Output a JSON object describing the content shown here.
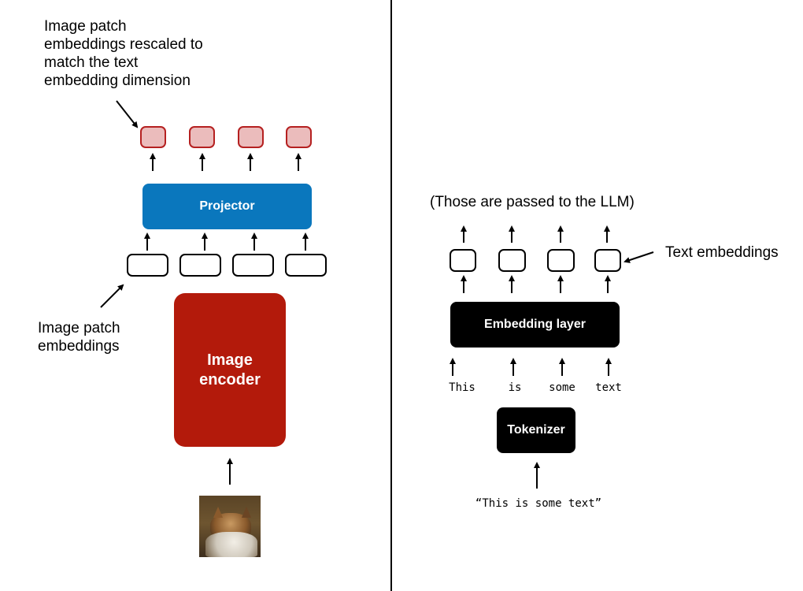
{
  "left": {
    "top_annotation": "Image patch embeddings rescaled to match the text embedding dimension",
    "top_annotation_lines": [
      "Image patch",
      "embeddings rescaled to",
      "match the text",
      "embedding dimension"
    ],
    "projector_label": "Projector",
    "patch_annotation_lines": [
      "Image patch",
      "embeddings"
    ],
    "encoder_label_lines": [
      "Image",
      "encoder"
    ],
    "input_image": "cat-photo",
    "colors": {
      "projector": "#0a77bd",
      "encoder": "#b31a0b",
      "projected_embedding_fill": "#ebbcbc",
      "projected_embedding_border": "#b52020"
    }
  },
  "right": {
    "llm_note": "(Those are passed to the LLM)",
    "text_embeddings_label": "Text embeddings",
    "embedding_layer_label": "Embedding layer",
    "tokens": [
      "This",
      "is",
      "some",
      "text"
    ],
    "tokenizer_label": "Tokenizer",
    "input_text": "“This is some text”",
    "colors": {
      "blocks": "#000000"
    }
  }
}
